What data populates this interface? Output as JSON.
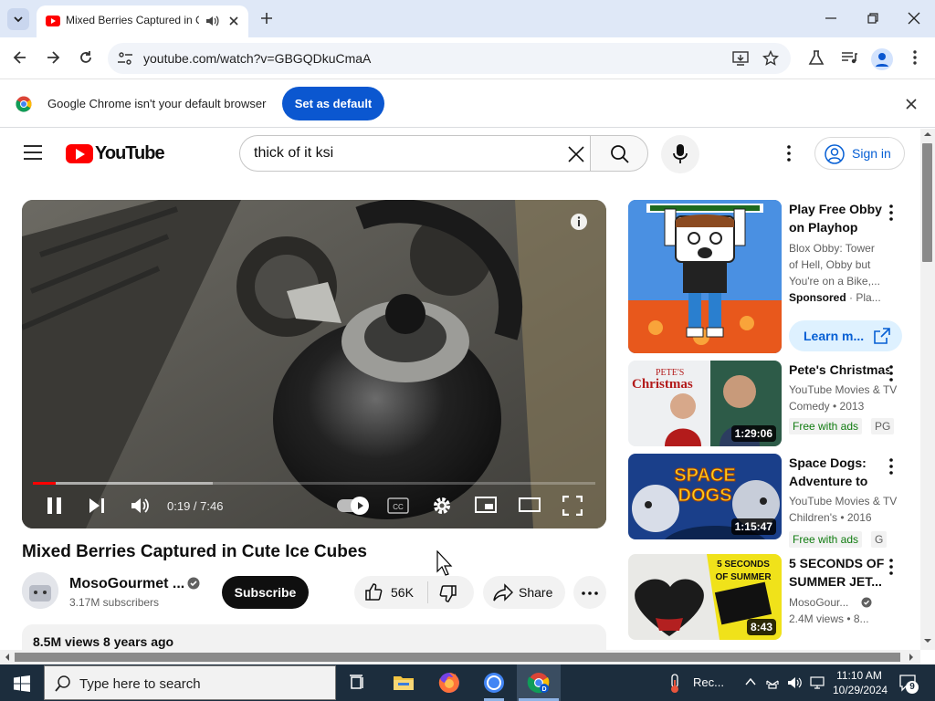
{
  "browser": {
    "tab_title": "Mixed Berries Captured in Cute Ice Cubes",
    "url": "youtube.com/watch?v=GBGQDkuCmaA",
    "infobar_message": "Google Chrome isn't your default browser",
    "infobar_button": "Set as default"
  },
  "youtube": {
    "logo_text": "YouTube",
    "search_query": "thick of it ksi",
    "sign_in": "Sign in"
  },
  "player": {
    "time": "0:19 / 7:46",
    "played_fraction": 0.04,
    "buffered_fraction": 0.32
  },
  "video": {
    "title": "Mixed Berries Captured in Cute Ice Cubes",
    "channel": "MosoGourmet ...",
    "subscribers": "3.17M subscribers",
    "subscribe_label": "Subscribe",
    "likes": "56K",
    "share_label": "Share",
    "views_age": "8.5M views  8 years ago"
  },
  "recommendations": [
    {
      "title": "Play Free Obby on Playhop",
      "meta1": "Blox Obby: Tower",
      "meta2": "of Hell, Obby but",
      "meta3": "You're on a Bike,...",
      "sponsored": "Sponsored",
      "sponsor_suffix": " · Pla...",
      "cta": "Learn m..."
    },
    {
      "title": "Pete's Christmas",
      "meta1": "YouTube Movies & TV",
      "meta2": "Comedy • 2013",
      "badge1": "Free with ads",
      "badge2": "PG",
      "duration": "1:29:06",
      "thumb_text1": "PETE'S",
      "thumb_text2": "Christmas"
    },
    {
      "title": "Space Dogs: Adventure to the...",
      "meta1": "YouTube Movies & TV",
      "meta2": "Children's • 2016",
      "badge1": "Free with ads",
      "badge2": "G",
      "duration": "1:15:47",
      "thumb_text1": "SPACE",
      "thumb_text2": "DOGS"
    },
    {
      "title": "5 SECONDS OF SUMMER JET...",
      "meta1": "MosoGour...",
      "meta2": "2.4M views • 8...",
      "duration": "8:43",
      "thumb_text1": "5 SECONDS",
      "thumb_text2": "OF SUMMER"
    }
  ],
  "taskbar": {
    "search_placeholder": "Type here to search",
    "tray_label": "Rec...",
    "time": "11:10 AM",
    "date": "10/29/2024",
    "notifications": "9"
  }
}
